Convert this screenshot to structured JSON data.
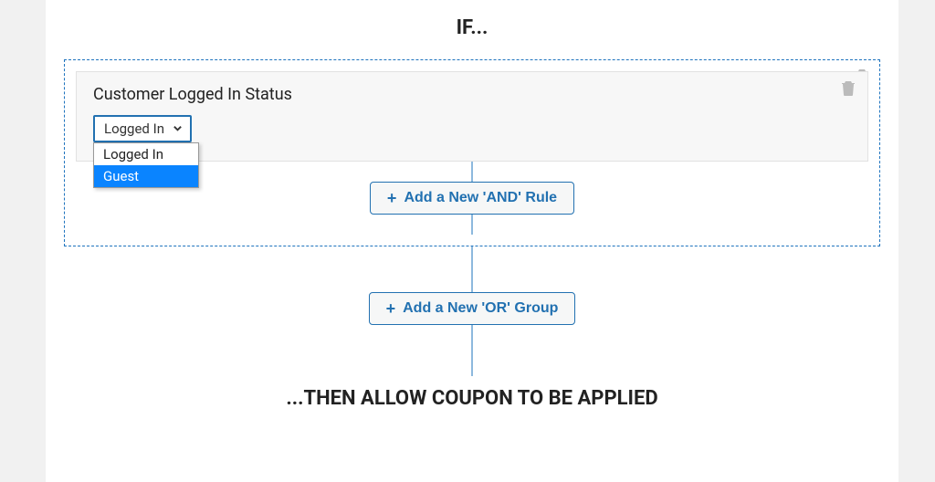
{
  "headings": {
    "if": "IF...",
    "then": "...THEN ALLOW COUPON TO BE APPLIED"
  },
  "rule": {
    "title": "Customer Logged In Status",
    "selected": "Logged In",
    "options": [
      "Logged In",
      "Guest"
    ],
    "highlighted_index": 1
  },
  "buttons": {
    "add_and": "Add a New 'AND' Rule",
    "add_or": "Add a New 'OR' Group"
  },
  "icons": {
    "plus": "+",
    "trash": "trash"
  }
}
